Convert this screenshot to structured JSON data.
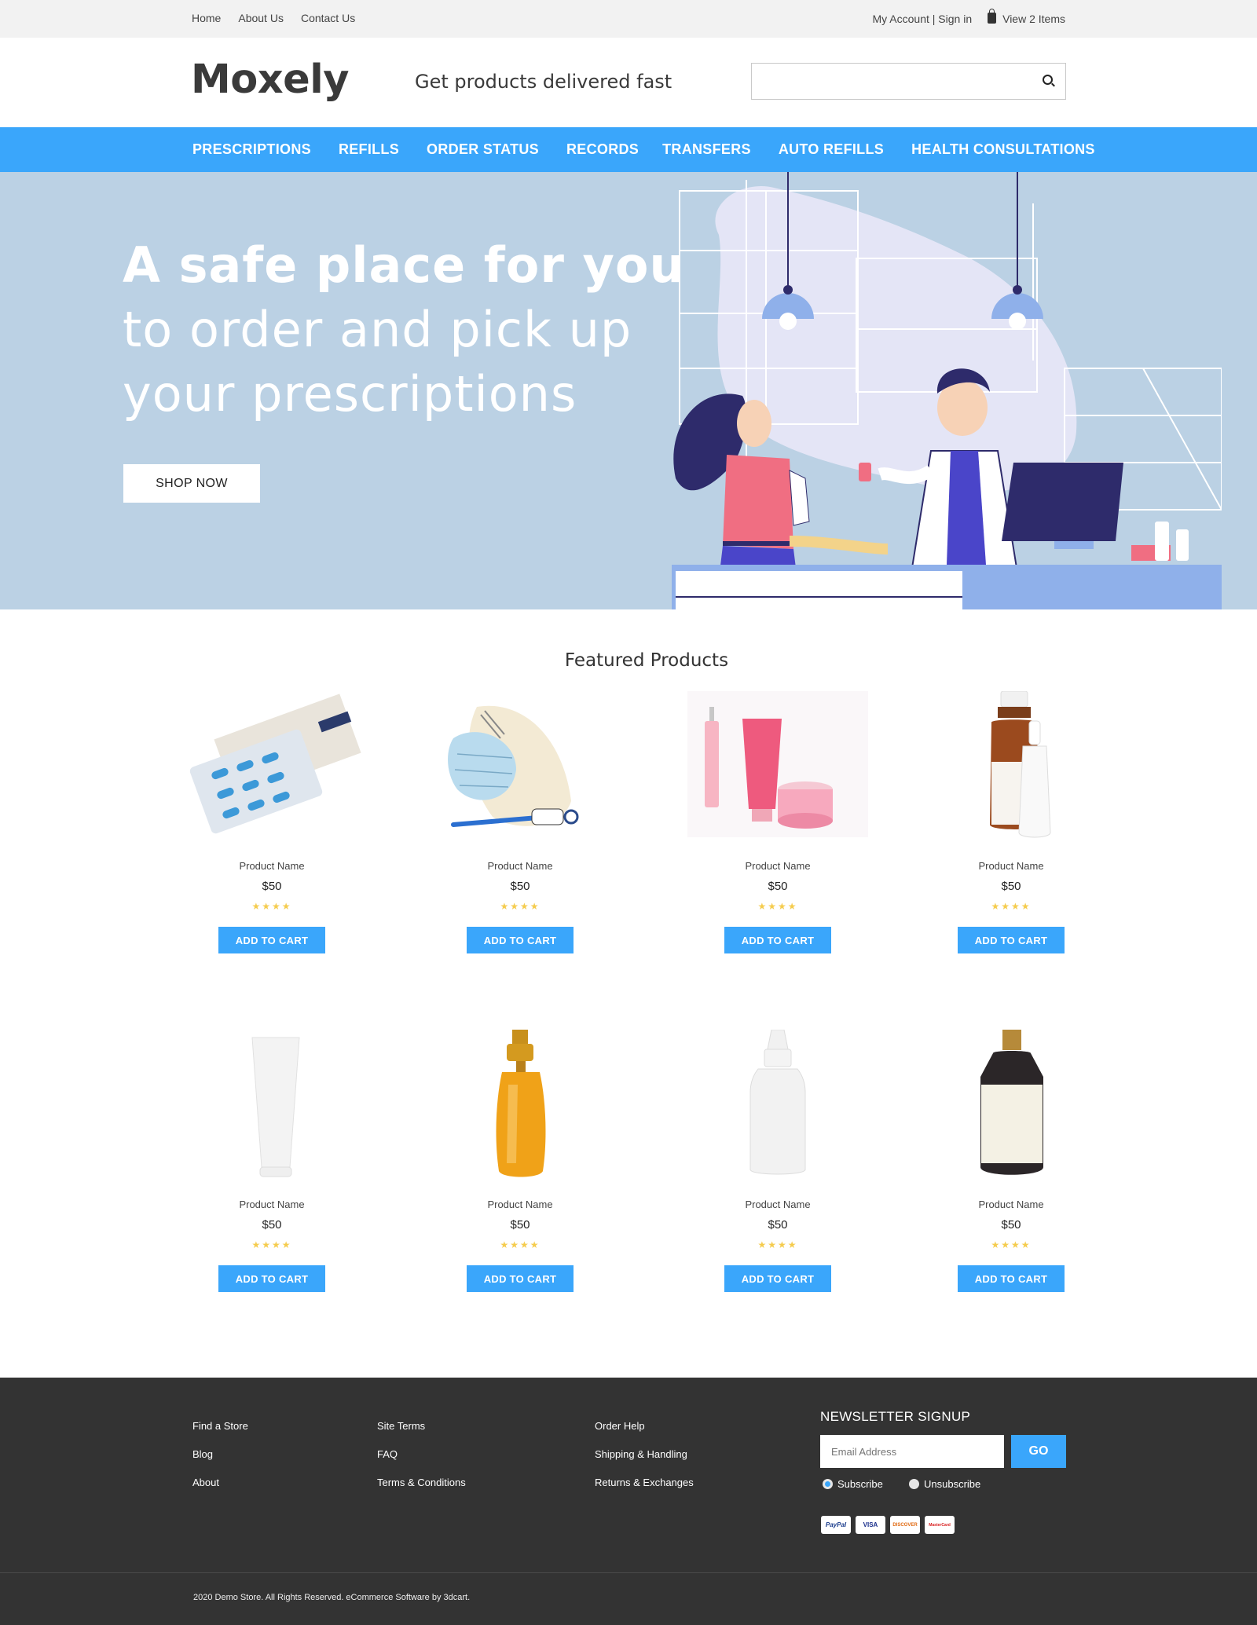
{
  "topbar": {
    "links": [
      "Home",
      "About Us",
      "Contact Us"
    ],
    "account": "My Account | Sign in",
    "cart": "View 2 Items"
  },
  "header": {
    "logo": "Moxely",
    "tagline": "Get products delivered fast",
    "search_placeholder": ""
  },
  "nav": [
    "PRESCRIPTIONS",
    "REFILLS",
    "ORDER STATUS",
    "RECORDS",
    "TRANSFERS",
    "AUTO REFILLS",
    "HEALTH CONSULTATIONS"
  ],
  "hero": {
    "line1": "A safe place for you",
    "line2": "to order and pick up",
    "line3": "your prescriptions",
    "button": "SHOP NOW"
  },
  "featured": {
    "title": "Featured Products",
    "products": [
      {
        "name": "Product Name",
        "price": "$50",
        "stars": "★★★★",
        "button": "ADD TO CART",
        "icon": "pill-blister-pack"
      },
      {
        "name": "Product Name",
        "price": "$50",
        "stars": "★★★★",
        "button": "ADD TO CART",
        "icon": "first-aid-kit"
      },
      {
        "name": "Product Name",
        "price": "$50",
        "stars": "★★★★",
        "button": "ADD TO CART",
        "icon": "cosmetic-tubes"
      },
      {
        "name": "Product Name",
        "price": "$50",
        "stars": "★★★★",
        "button": "ADD TO CART",
        "icon": "medicine-bottles"
      },
      {
        "name": "Product Name",
        "price": "$50",
        "stars": "★★★★",
        "button": "ADD TO CART",
        "icon": "white-tube"
      },
      {
        "name": "Product Name",
        "price": "$50",
        "stars": "★★★★",
        "button": "ADD TO CART",
        "icon": "amber-pump-bottle"
      },
      {
        "name": "Product Name",
        "price": "$50",
        "stars": "★★★★",
        "button": "ADD TO CART",
        "icon": "dropper-bottle"
      },
      {
        "name": "Product Name",
        "price": "$50",
        "stars": "★★★★",
        "button": "ADD TO CART",
        "icon": "black-cap-bottle"
      }
    ]
  },
  "footer": {
    "col1": [
      "Find a Store",
      "Blog",
      "About"
    ],
    "col2": [
      "Site Terms",
      "FAQ",
      "Terms & Conditions"
    ],
    "col3": [
      "Order Help",
      "Shipping & Handling",
      "Returns & Exchanges"
    ],
    "newsletter_title": "NEWSLETTER SIGNUP",
    "email_placeholder": "Email Address",
    "go": "GO",
    "subscribe": "Subscribe",
    "unsubscribe": "Unsubscribe",
    "payment_cards": [
      "PayPal",
      "VISA",
      "DISCOVER",
      "MasterCard"
    ],
    "copyright": "2020  Demo Store. All Rights Reserved. eCommerce Software by 3dcart."
  },
  "colors": {
    "accent": "#3aa6fb",
    "hero_bg": "#bbd1e4",
    "footer_bg": "#333333",
    "stars": "#f5cc4e"
  }
}
